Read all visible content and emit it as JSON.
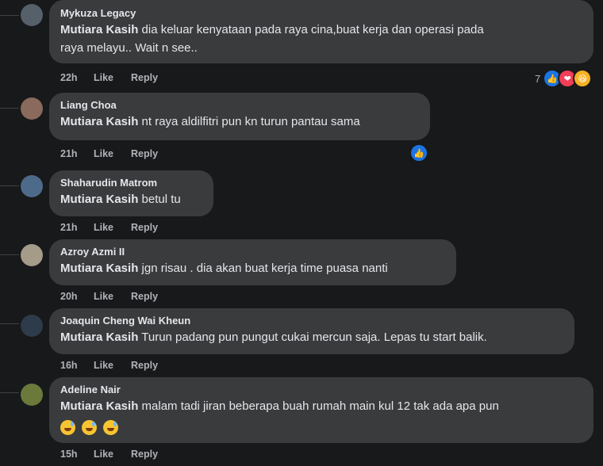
{
  "comments": [
    {
      "author": "Mykuza Legacy",
      "mention": "Mutiara Kasih",
      "text_lines": [
        " dia keluar kenyataan pada raya cina,buat kerja dan operasi pada",
        "raya melayu.. Wait n see.."
      ],
      "time": "22h",
      "like": "Like",
      "reply": "Reply",
      "reaction_count": "7",
      "reactions": [
        "like-icon",
        "love-icon",
        "haha-icon"
      ],
      "avatar_color": "#55606b"
    },
    {
      "author": "Liang Choa",
      "mention": "Mutiara Kasih",
      "text_lines": [
        " nt raya aldilfitri pun kn turun pantau sama"
      ],
      "time": "21h",
      "like": "Like",
      "reply": "Reply",
      "reaction_count": "",
      "reactions": [
        "like-icon"
      ],
      "avatar_color": "#8a6a5c"
    },
    {
      "author": "Shaharudin Matrom",
      "mention": "Mutiara Kasih",
      "text_lines": [
        " betul tu"
      ],
      "time": "21h",
      "like": "Like",
      "reply": "Reply",
      "reaction_count": "",
      "reactions": [],
      "avatar_color": "#4e6a8a"
    },
    {
      "author": "Azroy Azmi II",
      "mention": "Mutiara Kasih",
      "text_lines": [
        " jgn risau . dia akan buat kerja time puasa nanti"
      ],
      "time": "20h",
      "like": "Like",
      "reply": "Reply",
      "reaction_count": "",
      "reactions": [],
      "avatar_color": "#a49b89"
    },
    {
      "author": "Joaquin Cheng Wai Kheun",
      "mention": "Mutiara Kasih",
      "text_lines": [
        " Turun padang pun pungut cukai mercun saja. Lepas tu start balik."
      ],
      "time": "16h",
      "like": "Like",
      "reply": "Reply",
      "reaction_count": "",
      "reactions": [],
      "avatar_color": "#2e3b4a"
    },
    {
      "author": "Adeline Nair",
      "mention": "Mutiara Kasih",
      "text_lines": [
        " malam tadi jiran beberapa buah rumah main kul 12 tak ada apa pun"
      ],
      "emoji_line": [
        "grinning-sweat-emoji",
        "grinning-sweat-emoji",
        "grinning-sweat-emoji"
      ],
      "time": "15h",
      "like": "Like",
      "reply": "Reply",
      "reaction_count": "",
      "reactions": [],
      "avatar_color": "#6b7a3a"
    }
  ],
  "colors": {
    "background": "#18191a",
    "bubble": "#3a3b3c",
    "text": "#e4e6eb",
    "secondary": "#b0b3b8",
    "like": "#1b74e4",
    "love": "#f33e58",
    "haha": "#f7b125"
  }
}
